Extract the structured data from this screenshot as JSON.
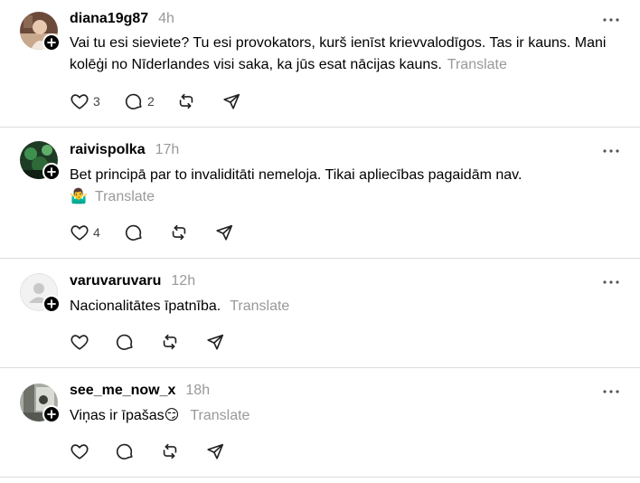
{
  "posts": [
    {
      "username": "diana19g87",
      "time": "4h",
      "text": "Vai tu esi sieviete? Tu esi provokators, kurš ienīst krievvalodīgos. Tas ir kauns. Mani kolēģi no Nīderlandes visi saka, ka jūs esat nācijas kauns.",
      "translate": "Translate",
      "likes": "3",
      "replies": "2"
    },
    {
      "username": "raivispolka",
      "time": "17h",
      "text": "Bet principā par to invaliditāti nemeloja. Tikai apliecības pagaidām nav.",
      "emoji": "🤷‍♂️",
      "translate": "Translate",
      "likes": "4",
      "replies": ""
    },
    {
      "username": "varuvaruvaru",
      "time": "12h",
      "text": "Nacionalitātes īpatnība.",
      "translate": "Translate",
      "likes": "",
      "replies": ""
    },
    {
      "username": "see_me_now_x",
      "time": "18h",
      "text": "Viņas ir īpašas😏",
      "translate": "Translate",
      "likes": "",
      "replies": ""
    }
  ],
  "icons": {
    "like": "heart-icon",
    "reply": "comment-icon",
    "repost": "repost-icon",
    "share": "send-icon",
    "more": "more-icon",
    "follow": "plus-icon"
  }
}
